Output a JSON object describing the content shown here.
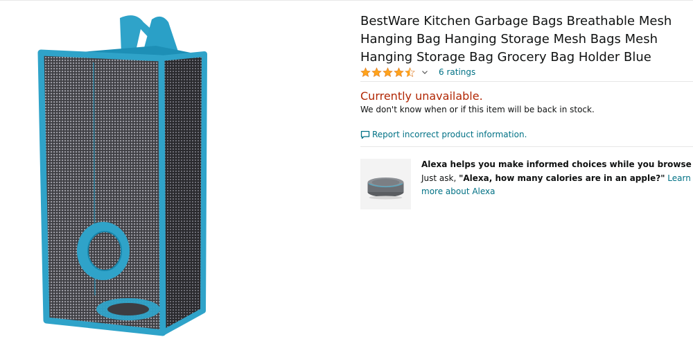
{
  "product": {
    "title": "BestWare Kitchen Garbage Bags Breathable Mesh Hanging Bag Hanging Storage Mesh Bags Mesh Hanging Storage Bag Grocery Bag Holder Blue",
    "image_icon": "mesh-bag-product-image",
    "rating": 4.5,
    "ratings_count_label": "6 ratings",
    "star_color": "#ffa41c"
  },
  "availability": {
    "status": "Currently unavailable.",
    "note": "We don't know when or if this item will be back in stock.",
    "status_color": "#b12704"
  },
  "report": {
    "label": "Report incorrect product information.",
    "icon": "speech-bubble-icon"
  },
  "alexa": {
    "heading": "Alexa helps you make informed choices while you browse",
    "prefix": "Just ask, ",
    "query": "\"Alexa, how many calories are in an apple?\"",
    "link_label": "Learn more about Alexa",
    "device_icon": "echo-dot-image"
  },
  "colors": {
    "link": "#007185",
    "bag_blue": "#2fa3c9"
  }
}
